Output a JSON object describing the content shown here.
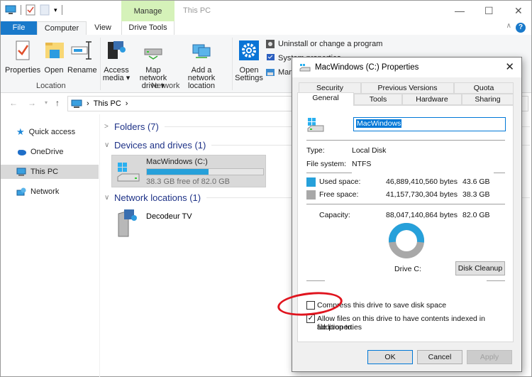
{
  "window": {
    "title": "This PC",
    "context_tab_group": "Manage",
    "controls": {
      "minimize": "—",
      "maximize": "☐",
      "close": "✕"
    }
  },
  "ribbon_tabs": [
    {
      "label": "File"
    },
    {
      "label": "Computer"
    },
    {
      "label": "View"
    },
    {
      "label": "Drive Tools"
    }
  ],
  "ribbon": {
    "location_group": {
      "label": "Location",
      "buttons": [
        {
          "label": "Properties",
          "icon": "properties-icon"
        },
        {
          "label": "Open",
          "icon": "folder-open-icon"
        },
        {
          "label": "Rename",
          "icon": "rename-icon"
        }
      ]
    },
    "network_group": {
      "label": "Network",
      "buttons": [
        {
          "label_line1": "Access",
          "label_line2": "media ▾",
          "icon": "media-icon"
        },
        {
          "label_line1": "Map network",
          "label_line2": "drive ▾",
          "icon": "network-drive-icon"
        },
        {
          "label_line1": "Add a network",
          "label_line2": "location",
          "icon": "network-location-icon"
        }
      ]
    },
    "system_group": {
      "open_settings_line1": "Open",
      "open_settings_line2": "Settings",
      "small_items": [
        {
          "label": "Uninstall or change a program"
        },
        {
          "label": "System properties"
        },
        {
          "label": "Manage"
        }
      ]
    }
  },
  "address_bar": {
    "path": [
      "This PC"
    ],
    "separator": "›"
  },
  "sidebar": {
    "items": [
      {
        "label": "Quick access",
        "icon": "star-icon"
      },
      {
        "label": "OneDrive",
        "icon": "cloud-icon"
      },
      {
        "label": "This PC",
        "icon": "computer-icon",
        "selected": true
      },
      {
        "label": "Network",
        "icon": "network-icon"
      }
    ]
  },
  "content": {
    "sections": [
      {
        "label": "Folders (7)",
        "expanded": false
      },
      {
        "label": "Devices and drives (1)",
        "expanded": true
      },
      {
        "label": "Network locations (1)",
        "expanded": true
      }
    ],
    "drive": {
      "name": "MacWindows (C:)",
      "free_text": "38.3 GB free of 82.0 GB",
      "used_fraction": 0.532,
      "bar_color": "#26a0da"
    },
    "network_location": {
      "name": "Decodeur TV"
    }
  },
  "dialog": {
    "title": "MacWindows (C:) Properties",
    "tabs_row1": [
      "Security",
      "Previous Versions",
      "Quota"
    ],
    "tabs_row2": [
      "General",
      "Tools",
      "Hardware",
      "Sharing"
    ],
    "active_tab": "General",
    "volume_label": "MacWindows",
    "type_label": "Type:",
    "type_value": "Local Disk",
    "fs_label": "File system:",
    "fs_value": "NTFS",
    "used": {
      "label": "Used space:",
      "bytes": "46,889,410,560 bytes",
      "size": "43.6 GB",
      "color": "#26a0da"
    },
    "free": {
      "label": "Free space:",
      "bytes": "41,157,730,304 bytes",
      "size": "38.3 GB",
      "color": "#a8a8a8"
    },
    "capacity": {
      "label": "Capacity:",
      "bytes": "88,047,140,864 bytes",
      "size": "82.0 GB"
    },
    "used_fraction": 0.532,
    "drive_caption": "Drive C:",
    "disk_cleanup": "Disk Cleanup",
    "compress_label": "Compress this drive to save disk space",
    "compress_checked": false,
    "index_label_line1": "Allow files on this drive to have contents indexed in addition to",
    "index_label_line2": "file properties",
    "index_checked": true,
    "buttons": {
      "ok": "OK",
      "cancel": "Cancel",
      "apply": "Apply"
    }
  },
  "annotation": {
    "color": "#e0141e",
    "target": "compress-checkbox"
  }
}
